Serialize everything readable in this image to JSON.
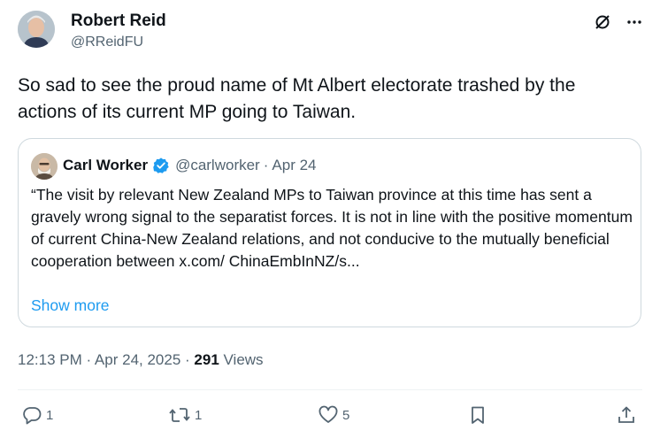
{
  "tweet": {
    "author_name": "Robert Reid",
    "author_handle": "@RReidFU",
    "text": "So sad to see the proud name of Mt Albert electorate trashed by the actions of its current MP going to Taiwan.",
    "timestamp": "12:13 PM · Apr 24, 2025",
    "meta_sep": " · ",
    "views_count": "291",
    "views_label": " Views"
  },
  "quote": {
    "author_name": "Carl Worker",
    "author_handle": "@carlworker",
    "separator": "·",
    "date": "Apr 24",
    "text": "“The visit by relevant New Zealand MPs to Taiwan province at this time has sent a gravely wrong signal to the separatist forces. It is not in line with the positive momentum of current China-New Zealand relations, and not conducive to the mutually beneficial cooperation between x.com/ ChinaEmbInNZ/s...",
    "show_more": "Show more"
  },
  "actions": {
    "reply_count": "1",
    "repost_count": "1",
    "like_count": "5"
  },
  "colors": {
    "accent": "#1d9bf0",
    "text_primary": "#0f1419",
    "text_secondary": "#536471",
    "border": "#cfd9de"
  },
  "icons": [
    "grok-icon",
    "more-icon",
    "verified-badge-icon",
    "reply-icon",
    "repost-icon",
    "like-icon",
    "bookmark-icon",
    "share-icon"
  ]
}
